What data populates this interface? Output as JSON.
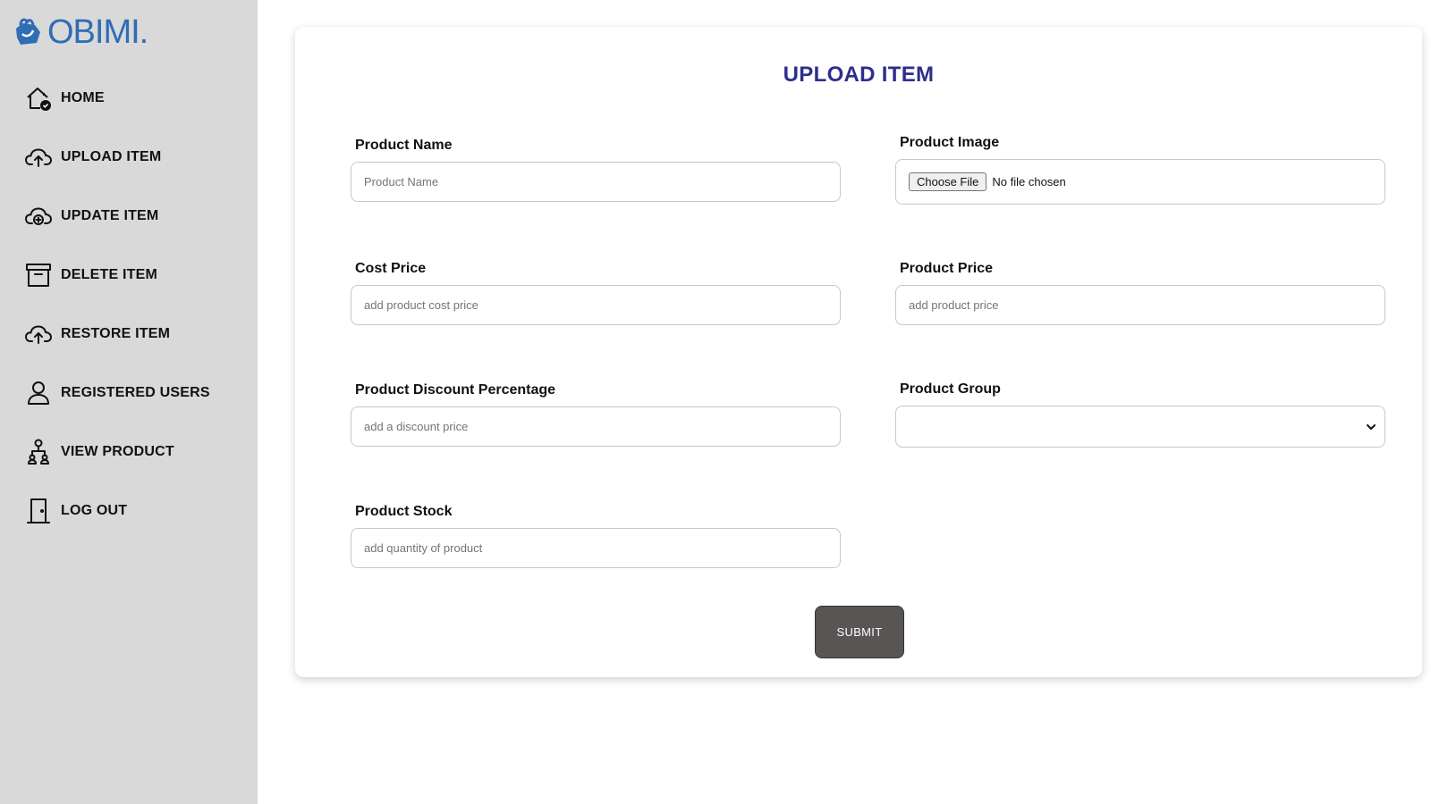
{
  "brand": {
    "logo_text": "OBIMI.",
    "accent_color": "#2f6db5"
  },
  "sidebar": {
    "items": [
      {
        "label": "HOME",
        "icon": "home-check-icon"
      },
      {
        "label": "UPLOAD ITEM",
        "icon": "cloud-upload-icon"
      },
      {
        "label": "UPDATE ITEM",
        "icon": "cloud-plus-icon"
      },
      {
        "label": "DELETE ITEM",
        "icon": "archive-icon"
      },
      {
        "label": "RESTORE ITEM",
        "icon": "cloud-upload-icon"
      },
      {
        "label": "REGISTERED USERS",
        "icon": "user-icon"
      },
      {
        "label": "VIEW PRODUCT",
        "icon": "hierarchy-icon"
      },
      {
        "label": "LOG OUT",
        "icon": "door-icon"
      }
    ]
  },
  "form": {
    "title": "UPLOAD ITEM",
    "title_color": "#2e2e8c",
    "product_name": {
      "label": "Product Name",
      "placeholder": "Product Name",
      "value": ""
    },
    "product_image": {
      "label": "Product Image",
      "button": "Choose File",
      "status": "No file chosen"
    },
    "cost_price": {
      "label": "Cost Price",
      "placeholder": "add product cost price",
      "value": ""
    },
    "product_price": {
      "label": "Product Price",
      "placeholder": "add product price",
      "value": ""
    },
    "discount": {
      "label": "Product Discount Percentage",
      "placeholder": "add a discount price",
      "value": ""
    },
    "group": {
      "label": "Product Group",
      "selected": ""
    },
    "stock": {
      "label": "Product Stock",
      "placeholder": "add quantity of product",
      "value": ""
    },
    "submit_label": "SUBMIT",
    "submit_color": "#595555"
  }
}
